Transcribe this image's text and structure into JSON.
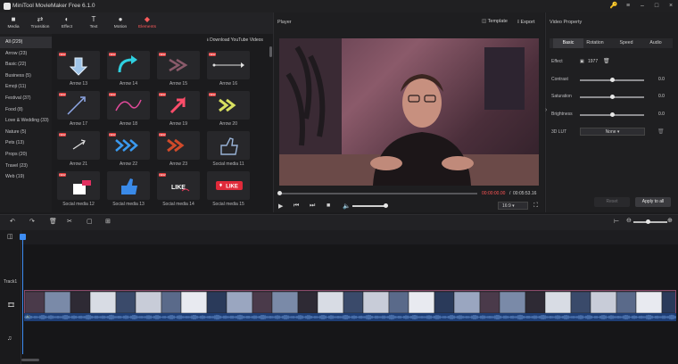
{
  "window": {
    "title": "MiniTool MovieMaker Free 6.1.0",
    "controls": [
      "key-icon",
      "menu-icon",
      "minimize-icon",
      "maximize-icon",
      "close-icon"
    ]
  },
  "toolbar": {
    "items": [
      {
        "label": "Media",
        "icon": "folder-icon"
      },
      {
        "label": "Transition",
        "icon": "transition-icon"
      },
      {
        "label": "Effect",
        "icon": "effect-icon"
      },
      {
        "label": "Text",
        "icon": "text-icon"
      },
      {
        "label": "Motion",
        "icon": "motion-icon"
      },
      {
        "label": "Elements",
        "icon": "elements-icon",
        "active": true
      }
    ]
  },
  "categories": [
    {
      "label": "All (229)",
      "selected": true
    },
    {
      "label": "Arrow (23)"
    },
    {
      "label": "Basic (22)"
    },
    {
      "label": "Business (5)"
    },
    {
      "label": "Emoji (11)"
    },
    {
      "label": "Festival (37)"
    },
    {
      "label": "Food (8)"
    },
    {
      "label": "Love & Wedding (33)"
    },
    {
      "label": "Nature (5)"
    },
    {
      "label": "Pets (13)"
    },
    {
      "label": "Props (20)"
    },
    {
      "label": "Travel (23)"
    },
    {
      "label": "Web (19)"
    }
  ],
  "download_label": "Download YouTube Videos",
  "elements": [
    {
      "label": "Arrow 13",
      "new": true,
      "new_label": "NEW",
      "art": "down-arrow"
    },
    {
      "label": "Arrow 14",
      "new": true,
      "new_label": "NEW",
      "art": "curve-arrow"
    },
    {
      "label": "Arrow 15",
      "new": true,
      "new_label": "NEW",
      "art": "double-chevron"
    },
    {
      "label": "Arrow 16",
      "new": true,
      "new_label": "NEW",
      "art": "line-arrow"
    },
    {
      "label": "Arrow 17",
      "new": true,
      "new_label": "NEW",
      "art": "check-arrow"
    },
    {
      "label": "Arrow 18",
      "new": true,
      "new_label": "NEW",
      "art": "curl-arrow"
    },
    {
      "label": "Arrow 19",
      "new": true,
      "new_label": "NEW",
      "art": "red-arrow"
    },
    {
      "label": "Arrow 20",
      "new": true,
      "new_label": "NEW",
      "art": "yellow-chevron"
    },
    {
      "label": "Arrow 21",
      "new": true,
      "new_label": "NEW",
      "art": "small-arrow"
    },
    {
      "label": "Arrow 22",
      "new": true,
      "new_label": "NEW",
      "art": "blue-chevrons"
    },
    {
      "label": "Arrow 23",
      "new": true,
      "new_label": "NEW",
      "art": "orange-chevrons"
    },
    {
      "label": "Social media 11",
      "new": false,
      "new_label": "",
      "art": "like-outline"
    },
    {
      "label": "Social media 12",
      "new": true,
      "new_label": "NEW",
      "art": "thumb-pink"
    },
    {
      "label": "Social media 13",
      "new": false,
      "new_label": "",
      "art": "thumb-blue"
    },
    {
      "label": "Social media 14",
      "new": true,
      "new_label": "NEW",
      "art": "like-text",
      "art_text": "LIKE"
    },
    {
      "label": "Social media 15",
      "new": false,
      "new_label": "",
      "art": "like-heart",
      "art_text": "LIKE"
    }
  ],
  "player": {
    "title": "Player",
    "template_label": "Template",
    "export_label": "Export",
    "time_current": "00:00:00.00",
    "time_separator": "/",
    "time_total": "00:05:53.16",
    "aspect": "16:9",
    "volume": 0.9,
    "progress": 0
  },
  "property": {
    "title": "Video Property",
    "tabs": [
      "Basic",
      "Rotation",
      "Speed",
      "Audio"
    ],
    "selected_tab": "Basic",
    "effect_label": "Effect",
    "effect_value": "1977",
    "sliders": [
      {
        "label": "Contrast",
        "value": "0.0",
        "level": 0.5
      },
      {
        "label": "Saturation",
        "value": "0.0",
        "level": 0.5
      },
      {
        "label": "Brightness",
        "value": "0.0",
        "level": 0.5
      }
    ],
    "lut_label": "3D LUT",
    "lut_value": "None",
    "reset_label": "Reset",
    "apply_label": "Apply to all"
  },
  "timeline": {
    "track_label": "Track1",
    "zoom_level": 0.4
  },
  "colors": {
    "accent": "#ff5b5b",
    "playhead": "#3e8df3",
    "audio": "#1e3e76",
    "clip_border": "#8a4a6a"
  }
}
